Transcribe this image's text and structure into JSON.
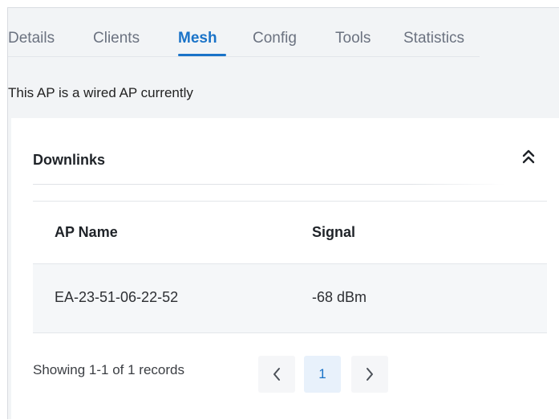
{
  "tabs": [
    {
      "label": "Details"
    },
    {
      "label": "Clients"
    },
    {
      "label": "Mesh"
    },
    {
      "label": "Config"
    },
    {
      "label": "Tools"
    },
    {
      "label": "Statistics"
    }
  ],
  "active_tab": "Mesh",
  "status_message": "This AP is a wired AP currently",
  "downlinks": {
    "title": "Downlinks",
    "collapse_icon": "chevrons-up-icon",
    "columns": [
      "AP Name",
      "Signal"
    ],
    "rows": [
      {
        "ap_name": "EA-23-51-06-22-52",
        "signal": "-68 dBm"
      }
    ],
    "pagination": {
      "summary": "Showing 1-1 of 1 records",
      "current_page": "1",
      "prev_icon": "chevron-left-icon",
      "next_icon": "chevron-right-icon"
    }
  },
  "colors": {
    "accent": "#1a73c8",
    "background": "#f2f4f6",
    "panel": "#ffffff"
  }
}
